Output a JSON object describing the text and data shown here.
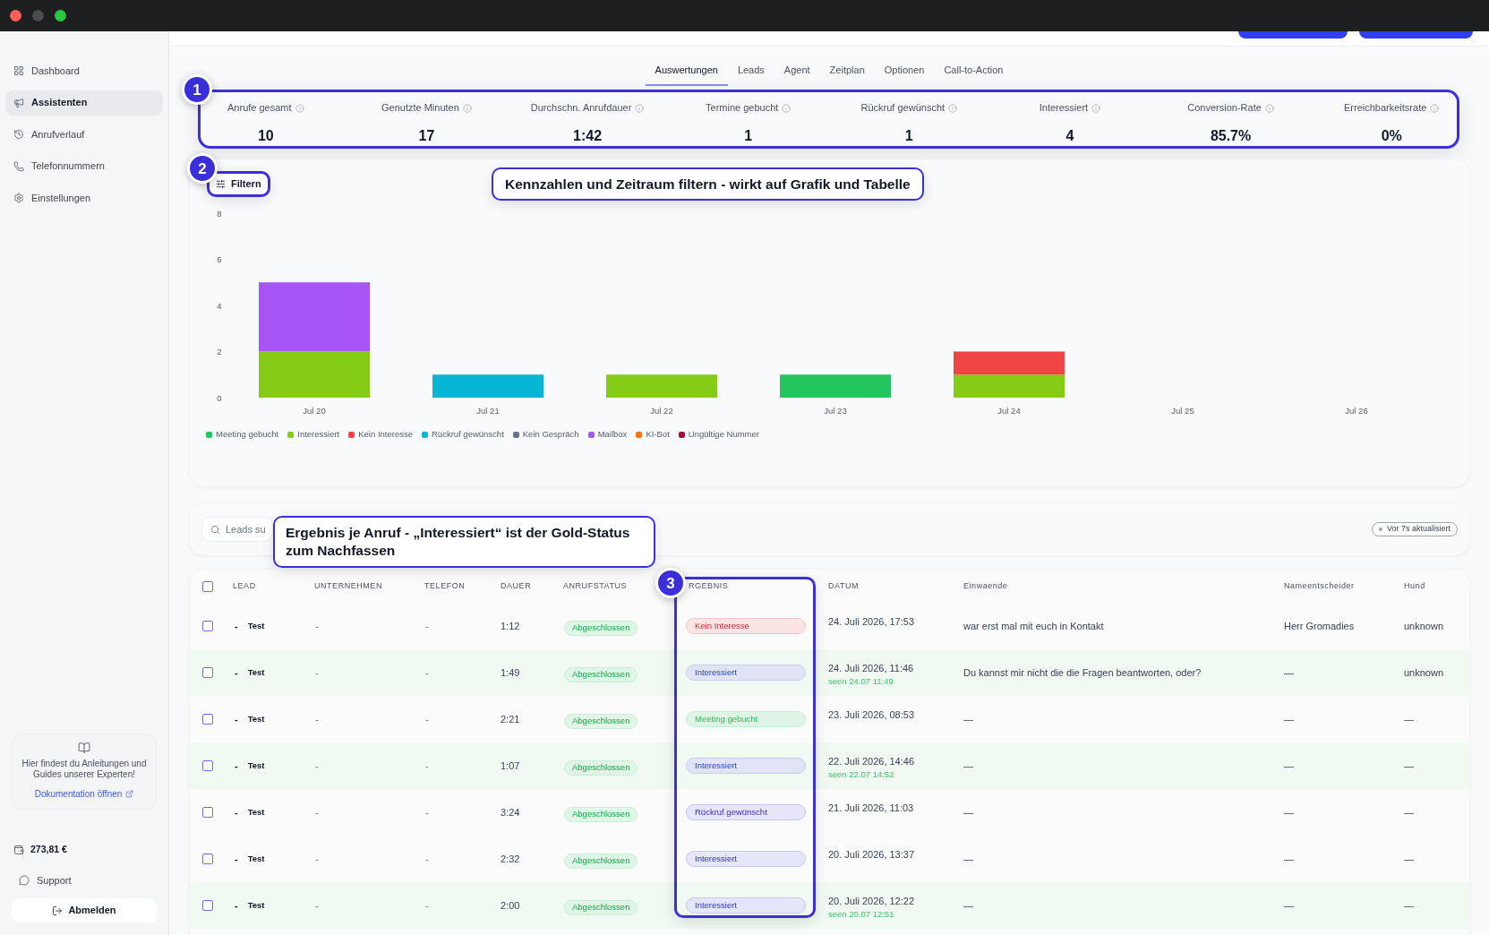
{
  "window": {
    "buttons": [
      {
        "kind": "close",
        "disabled": false
      },
      {
        "kind": "minimize",
        "disabled": true
      },
      {
        "kind": "zoom",
        "disabled": false
      }
    ]
  },
  "sidebar": {
    "items": [
      {
        "label": "Dashboard",
        "selected": false
      },
      {
        "label": "Assistenten",
        "selected": true
      },
      {
        "label": "Anrufverlauf",
        "selected": false
      },
      {
        "label": "Telefonnummern",
        "selected": false
      },
      {
        "label": "Einstellungen",
        "selected": false
      }
    ],
    "docs_card": {
      "text": "Hier findest du Anleitungen und Guides unserer Experten!",
      "link": "Dokumentation öffnen"
    },
    "balance": "273,81 €",
    "support": "Support",
    "logout": "Abmelden"
  },
  "tabs": [
    {
      "label": "Auswertungen",
      "selected": true
    },
    {
      "label": "Leads",
      "selected": false
    },
    {
      "label": "Agent",
      "selected": false
    },
    {
      "label": "Zeitplan",
      "selected": false
    },
    {
      "label": "Optionen",
      "selected": false
    },
    {
      "label": "Call-to-Action",
      "selected": false
    }
  ],
  "kpis": [
    {
      "label": "Anrufe gesamt",
      "value": "10"
    },
    {
      "label": "Genutzte Minuten",
      "value": "17"
    },
    {
      "label": "Durchschn. Anrufdauer",
      "value": "1:42"
    },
    {
      "label": "Termine gebucht",
      "value": "1"
    },
    {
      "label": "Rückruf gewünscht",
      "value": "1"
    },
    {
      "label": "Interessiert",
      "value": "4"
    },
    {
      "label": "Conversion-Rate",
      "value": "85.7%"
    },
    {
      "label": "Erreichbarkeitsrate",
      "value": "0%"
    }
  ],
  "filter_button": "Filtern",
  "chart": {
    "chart_data": {
      "type": "bar",
      "stacked": true,
      "legend": "bottom",
      "categories": [
        "Jul 20",
        "Jul 21",
        "Jul 22",
        "Jul 23",
        "Jul 24",
        "Jul 25",
        "Jul 26"
      ],
      "series": [
        {
          "name": "Meeting gebucht",
          "color": "#22c55e",
          "values": [
            0,
            0,
            0,
            1,
            0,
            0,
            0
          ]
        },
        {
          "name": "Interessiert",
          "color": "#84cc16",
          "values": [
            2,
            0,
            1,
            0,
            1,
            0,
            0
          ]
        },
        {
          "name": "Kein Interesse",
          "color": "#ef4444",
          "values": [
            0,
            0,
            0,
            0,
            1,
            0,
            0
          ]
        },
        {
          "name": "Rückruf gewünscht",
          "color": "#06b6d4",
          "values": [
            0,
            1,
            0,
            0,
            0,
            0,
            0
          ]
        },
        {
          "name": "Kein Gespräch",
          "color": "#64748b",
          "values": [
            0,
            0,
            0,
            0,
            0,
            0,
            0
          ]
        },
        {
          "name": "Mailbox",
          "color": "#a855f7",
          "values": [
            3,
            0,
            0,
            0,
            0,
            0,
            0
          ]
        },
        {
          "name": "KI-Bot",
          "color": "#f97316",
          "values": [
            0,
            0,
            0,
            0,
            0,
            0,
            0
          ]
        },
        {
          "name": "Ungültige Nummer",
          "color": "#9f1239",
          "values": [
            0,
            0,
            0,
            0,
            0,
            0,
            0
          ]
        }
      ],
      "ylim": [
        0,
        8
      ],
      "yticks": [
        0,
        2,
        4,
        6,
        8
      ]
    }
  },
  "search": {
    "placeholder": "Leads su"
  },
  "refresh_status": "Vor 7s aktualisiert",
  "table": {
    "header_checked": false,
    "columns": [
      "LEAD",
      "UNTERNEHMEN",
      "TELEFON",
      "DAUER",
      "ANRUFSTATUS",
      "RGEBNIS",
      "DATUM",
      "Einwaende",
      "Nameentscheider",
      "Hund"
    ],
    "rows": [
      {
        "checked": false,
        "lead_prefix": "-",
        "lead": "Test",
        "company": "-",
        "phone": "-",
        "duration": "1:12",
        "status": "Abgeschlossen",
        "result": {
          "label": "Kein Interesse",
          "color": "#fde4e4"
        },
        "date": "24. Juli 2026, 17:53",
        "objection": "war erst mal mit euch in Kontakt",
        "decision_maker": "Herr Gromadies",
        "dog": "unknown"
      },
      {
        "checked": false,
        "lead_prefix": "-",
        "lead": "Test",
        "company": "-",
        "phone": "-",
        "duration": "1:49",
        "status": "Abgeschlossen",
        "result": {
          "label": "Interessiert",
          "color": "#e0e4f6"
        },
        "date": "24. Juli 2026, 11:46",
        "seen": "seen 24.07 11:49",
        "objection": "Du kannst mir nicht die die Fragen beantworten, oder?",
        "decision_maker": "—",
        "dog": "unknown"
      },
      {
        "checked": false,
        "lead_prefix": "-",
        "lead": "Test",
        "company": "-",
        "phone": "-",
        "duration": "2:21",
        "status": "Abgeschlossen",
        "result": {
          "label": "Meeting gebucht",
          "color": "#e0f4e6"
        },
        "date": "23. Juli 2026, 08:53",
        "objection": "—",
        "decision_maker": "—",
        "dog": "—"
      },
      {
        "checked": false,
        "lead_prefix": "-",
        "lead": "Test",
        "company": "-",
        "phone": "-",
        "duration": "1:07",
        "status": "Abgeschlossen",
        "result": {
          "label": "Interessiert",
          "color": "#e0e4f6"
        },
        "date": "22. Juli 2026, 14:46",
        "seen": "seen 22.07 14:52",
        "objection": "—",
        "decision_maker": "—",
        "dog": "—"
      },
      {
        "checked": false,
        "lead_prefix": "-",
        "lead": "Test",
        "company": "-",
        "phone": "-",
        "duration": "3:24",
        "status": "Abgeschlossen",
        "result": {
          "label": "Rückruf gewünscht",
          "color": "#e7e5fb"
        },
        "date": "21. Juli 2026, 11:03",
        "objection": "—",
        "decision_maker": "—",
        "dog": "—"
      },
      {
        "checked": false,
        "lead_prefix": "-",
        "lead": "Test",
        "company": "-",
        "phone": "-",
        "duration": "2:32",
        "status": "Abgeschlossen",
        "result": {
          "label": "Interessiert",
          "color": "#e5e6fa"
        },
        "date": "20. Juli 2026, 13:37",
        "objection": "—",
        "decision_maker": "—",
        "dog": "—"
      },
      {
        "checked": false,
        "lead_prefix": "-",
        "lead": "Test",
        "company": "-",
        "phone": "-",
        "duration": "2:00",
        "status": "Abgeschlossen",
        "result": {
          "label": "Interessiert",
          "color": "#e5e6fa"
        },
        "date": "20. Juli 2026, 12:22",
        "seen": "seen 20.07 12:51",
        "objection": "—",
        "decision_maker": "—",
        "dog": "—"
      }
    ]
  },
  "annotations": [
    {
      "badge": "1"
    },
    {
      "badge": "2",
      "text": "Kennzahlen und Zeitraum filtern - wirkt auf Grafik und Tabelle"
    },
    {
      "badge": "3",
      "text": "Ergebnis je Anruf - „Interessiert“ ist der Gold-Status zum Nachfassen"
    }
  ]
}
